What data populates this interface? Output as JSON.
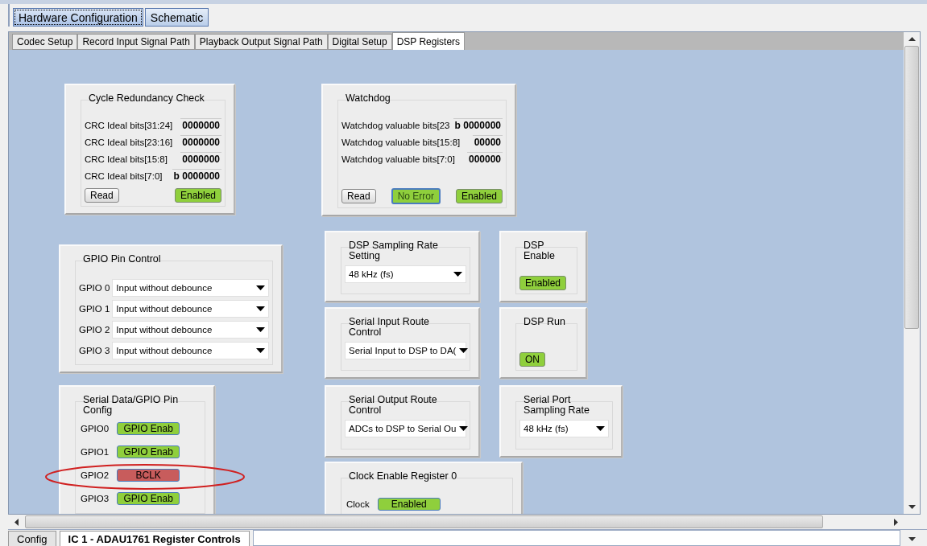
{
  "main_tabs": [
    {
      "label": "Hardware Configuration",
      "selected": true
    },
    {
      "label": "Schematic",
      "selected": false
    }
  ],
  "sub_tabs": [
    {
      "label": "Codec Setup",
      "selected": false
    },
    {
      "label": "Record Input Signal Path",
      "selected": false
    },
    {
      "label": "Playback Output Signal Path",
      "selected": false
    },
    {
      "label": "Digital Setup",
      "selected": false
    },
    {
      "label": "DSP Registers",
      "selected": true
    }
  ],
  "panels": [
    {
      "title": "Cycle Redundancy Check",
      "rows": [
        {
          "kind": "readout",
          "label": "CRC Ideal bits[31:24]",
          "value": "0000000"
        },
        {
          "kind": "readout",
          "label": "CRC Ideal bits[23:16]",
          "value": "0000000"
        },
        {
          "kind": "readout",
          "label": "CRC Ideal bits[15:8]",
          "value": "0000000"
        },
        {
          "kind": "readout",
          "label": "CRC Ideal bits[7:0]",
          "value": "b 0000000"
        },
        {
          "kind": "buttons",
          "buttons": [
            {
              "label": "Read",
              "kind": "plain"
            },
            {
              "label": "Enabled",
              "kind": "on"
            }
          ]
        }
      ]
    },
    {
      "title": "Watchdog",
      "rows": [
        {
          "kind": "readout",
          "label": "Watchdog valuable bits[23",
          "value": "b 0000000"
        },
        {
          "kind": "readout",
          "label": "Watchdog valuable bits[15:8]",
          "value": "00000"
        },
        {
          "kind": "readout",
          "label": "Watchdog valuable bits[7:0]",
          "value": "000000"
        },
        {
          "kind": "buttons",
          "buttons": [
            {
              "label": "Read",
              "kind": "plain"
            },
            {
              "label": "No Error",
              "kind": "status"
            },
            {
              "label": "Enabled",
              "kind": "on"
            }
          ]
        }
      ]
    },
    {
      "title": "GPIO Pin Control",
      "rows": [
        {
          "kind": "dropdown",
          "label": "GPIO 0",
          "value": "Input without debounce"
        },
        {
          "kind": "dropdown",
          "label": "GPIO 1",
          "value": "Input without debounce"
        },
        {
          "kind": "dropdown",
          "label": "GPIO 2",
          "value": "Input without debounce"
        },
        {
          "kind": "dropdown",
          "label": "GPIO 3",
          "value": "Input without debounce"
        }
      ]
    },
    {
      "title": "DSP Sampling Rate Setting",
      "rows": [
        {
          "kind": "dropdown",
          "value": "48 kHz (fs)"
        }
      ]
    },
    {
      "title": "DSP Enable",
      "rows": [
        {
          "kind": "buttons",
          "buttons": [
            {
              "label": "Enabled",
              "kind": "on"
            }
          ]
        }
      ]
    },
    {
      "title": "Serial Input Route Control",
      "rows": [
        {
          "kind": "dropdown",
          "value": "Serial Input to DSP to DA("
        }
      ]
    },
    {
      "title": "DSP Run",
      "rows": [
        {
          "kind": "buttons",
          "buttons": [
            {
              "label": "ON",
              "kind": "on"
            }
          ]
        }
      ]
    },
    {
      "title": "Serial Data/GPIO Pin Config",
      "rows": [
        {
          "kind": "pin",
          "label": "GPIO0",
          "button": {
            "label": "GPIO Enab",
            "kind": "on"
          }
        },
        {
          "kind": "pin",
          "label": "GPIO1",
          "button": {
            "label": "GPIO Enab",
            "kind": "on"
          }
        },
        {
          "kind": "pin",
          "label": "GPIO2",
          "button": {
            "label": "BCLK",
            "kind": "alert"
          }
        },
        {
          "kind": "pin",
          "label": "GPIO3",
          "button": {
            "label": "GPIO Enab",
            "kind": "on"
          }
        }
      ]
    },
    {
      "title": "Serial Output Route Control",
      "rows": [
        {
          "kind": "dropdown",
          "value": "ADCs to DSP to Serial Ou"
        }
      ]
    },
    {
      "title": "Serial Port Sampling Rate",
      "rows": [
        {
          "kind": "dropdown",
          "value": "48 kHz (fs)"
        }
      ]
    },
    {
      "title": "Clock Enable Register 0",
      "rows": [
        {
          "kind": "pin",
          "label": "Clock",
          "button": {
            "label": "Enabled",
            "kind": "on"
          }
        }
      ]
    }
  ],
  "bottom_tabs": [
    {
      "label": "Config",
      "selected": false
    },
    {
      "label": "IC 1 - ADAU1761 Register Controls",
      "selected": true
    }
  ]
}
